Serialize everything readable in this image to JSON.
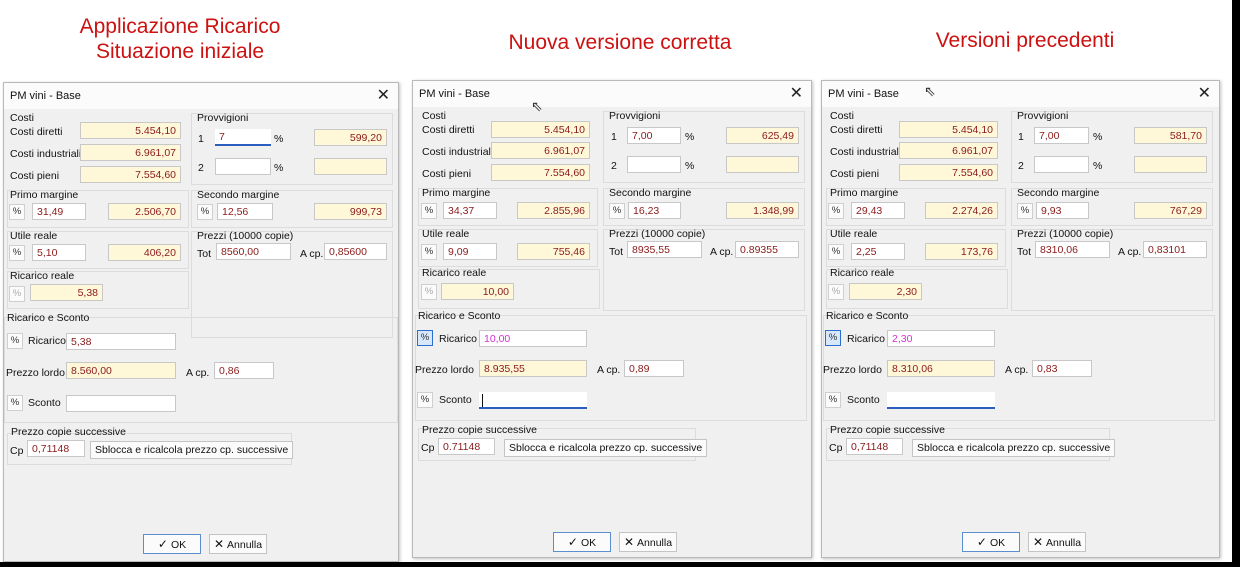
{
  "headings": {
    "left": [
      "Applicazione Ricarico",
      "Situazione iniziale"
    ],
    "middle": [
      "Nuova versione corretta"
    ],
    "right": [
      "Versioni precedenti"
    ]
  },
  "common": {
    "window_title": "PM vini - Base",
    "costi": "Costi",
    "costi_diretti": "Costi diretti",
    "costi_industriali": "Costi industriali",
    "costi_pieni": "Costi pieni",
    "provvigioni": "Provvigioni",
    "row1": "1",
    "row2": "2",
    "percent": "%",
    "primo_margine": "Primo margine",
    "secondo_margine": "Secondo margine",
    "utile_reale": "Utile reale",
    "prezzi": "Prezzi (10000 copie)",
    "tot": "Tot",
    "a_cp": "A cp.",
    "ricarico_reale": "Ricarico reale",
    "ricarico_e_sconto": "Ricarico e Sconto",
    "ricarico": "Ricarico",
    "prezzo_lordo": "Prezzo lordo",
    "sconto": "Sconto",
    "prezzo_copie": "Prezzo copie successive",
    "cp": "Cp",
    "sblocca": "Sblocca e ricalcola prezzo cp. successive",
    "ok": "OK",
    "annulla": "Annulla",
    "pct_glyph": "%",
    "ok_icon": "checkmark-icon",
    "cancel_icon": "x-icon"
  },
  "dialogs": [
    {
      "costi_diretti": "5.454,10",
      "costi_industriali": "6.961,07",
      "costi_pieni": "7.554,60",
      "prov1_pct": "7",
      "prov1_val": "599,20",
      "prov2_pct": "",
      "prov2_val": "",
      "primo_pct": "31,49",
      "primo_val": "2.506,70",
      "secondo_pct": "12,56",
      "secondo_val": "999,73",
      "utile_pct": "5,10",
      "utile_val": "406,20",
      "tot": "8560,00",
      "a_cp": "0,85600",
      "ricarico_reale": "5,38",
      "ricarico": "5,38",
      "prezzo_lordo": "8.560,00",
      "a_cp2": "0,86",
      "sconto": "",
      "cp": "0,71148"
    },
    {
      "costi_diretti": "5.454,10",
      "costi_industriali": "6.961,07",
      "costi_pieni": "7.554,60",
      "prov1_pct": "7,00",
      "prov1_val": "625,49",
      "prov2_pct": "",
      "prov2_val": "",
      "primo_pct": "34,37",
      "primo_val": "2.855,96",
      "secondo_pct": "16,23",
      "secondo_val": "1.348,99",
      "utile_pct": "9,09",
      "utile_val": "755,46",
      "tot": "8935,55",
      "a_cp": "0.89355",
      "ricarico_reale": "10,00",
      "ricarico": "10,00",
      "prezzo_lordo": "8.935,55",
      "a_cp2": "0,89",
      "sconto": "",
      "cp": "0.71148"
    },
    {
      "costi_diretti": "5.454,10",
      "costi_industriali": "6.961,07",
      "costi_pieni": "7.554,60",
      "prov1_pct": "7,00",
      "prov1_val": "581,70",
      "prov2_pct": "",
      "prov2_val": "",
      "primo_pct": "29,43",
      "primo_val": "2.274,26",
      "secondo_pct": "9,93",
      "secondo_val": "767,29",
      "utile_pct": "2,25",
      "utile_val": "173,76",
      "tot": "8310,06",
      "a_cp": "0,83101",
      "ricarico_reale": "2,30",
      "ricarico": "2,30",
      "prezzo_lordo": "8.310,06",
      "a_cp2": "0,83",
      "sconto": "",
      "cp": "0,71148"
    }
  ]
}
